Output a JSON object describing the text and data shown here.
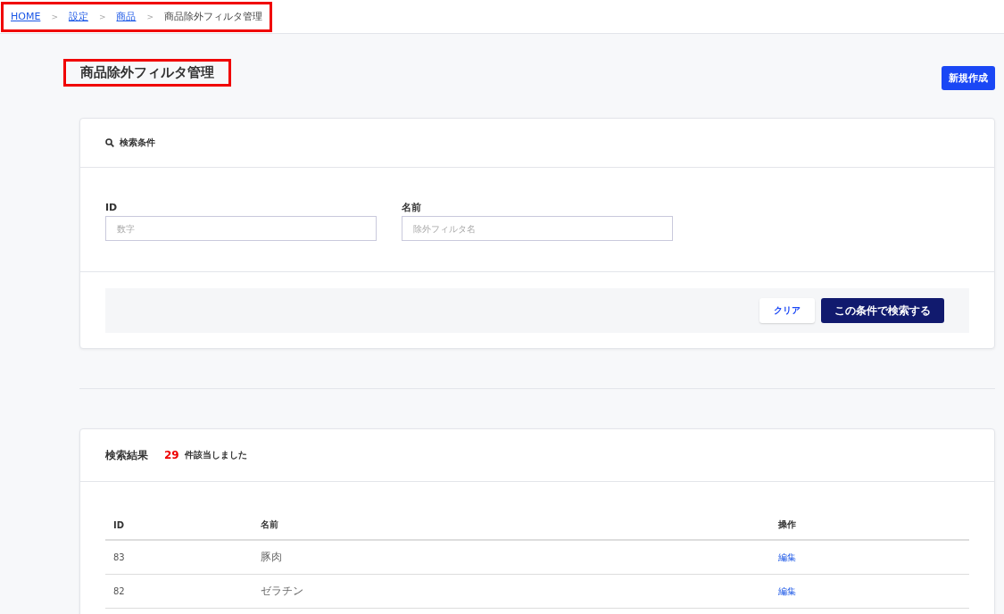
{
  "breadcrumb": {
    "highlighted": true,
    "items": [
      {
        "label": "HOME",
        "link": true
      },
      {
        "label": "設定",
        "link": true
      },
      {
        "label": "商品",
        "link": true
      },
      {
        "label": "商品除外フィルタ管理",
        "link": false
      }
    ],
    "separator": ">"
  },
  "page_title": {
    "text": "商品除外フィルタ管理",
    "highlighted": true
  },
  "new_button": "新規作成",
  "search": {
    "title": "検索条件",
    "fields": [
      {
        "label": "ID",
        "placeholder": "数字"
      },
      {
        "label": "名前",
        "placeholder": "除外フィルタ名"
      }
    ],
    "clear_button": "クリア",
    "submit_button": "この条件で検索する"
  },
  "results": {
    "title": "検索結果",
    "count": "29",
    "count_suffix": "件該当しました",
    "columns": [
      "ID",
      "名前",
      "操作"
    ],
    "rows": [
      {
        "id": "83",
        "name": "豚肉",
        "action": "編集"
      },
      {
        "id": "82",
        "name": "ゼラチン",
        "action": "編集"
      }
    ]
  }
}
